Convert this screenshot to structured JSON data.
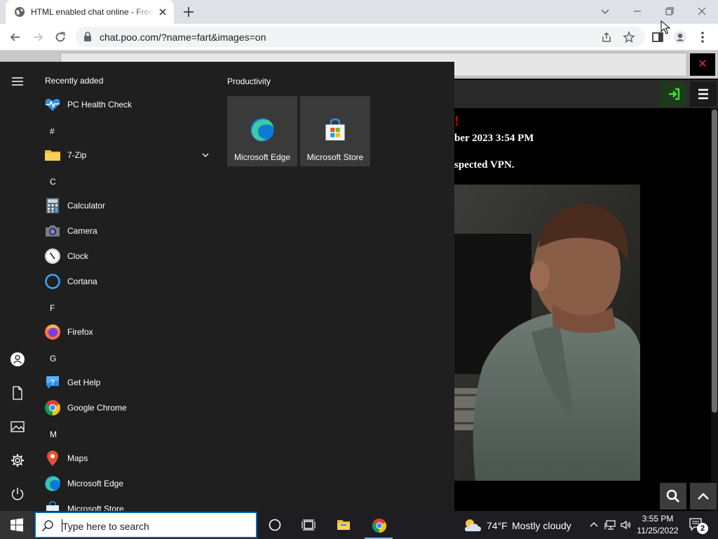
{
  "browser": {
    "tab_title": "HTML enabled chat online - Free",
    "url": "chat.poo.com/?name=fart&images=on"
  },
  "page": {
    "chat_lines": [
      "!",
      "ber 2023 3:54 PM",
      "spected VPN."
    ]
  },
  "start_menu": {
    "recent_header": "Recently added",
    "tiles_header": "Productivity",
    "tiles": [
      {
        "label": "Microsoft Edge",
        "icon": "edge-icon"
      },
      {
        "label": "Microsoft Store",
        "icon": "store-icon"
      }
    ],
    "apps": [
      {
        "label": "PC Health Check",
        "icon": "pc-health-check-icon"
      },
      {
        "letter": "#"
      },
      {
        "label": "7-Zip",
        "icon": "folder-icon"
      },
      {
        "letter": "C"
      },
      {
        "label": "Calculator",
        "icon": "calculator-icon"
      },
      {
        "label": "Camera",
        "icon": "camera-icon"
      },
      {
        "label": "Clock",
        "icon": "clock-icon"
      },
      {
        "label": "Cortana",
        "icon": "cortana-icon"
      },
      {
        "letter": "F"
      },
      {
        "label": "Firefox",
        "icon": "firefox-icon"
      },
      {
        "letter": "G"
      },
      {
        "label": "Get Help",
        "icon": "get-help-icon"
      },
      {
        "label": "Google Chrome",
        "icon": "chrome-icon"
      },
      {
        "letter": "M"
      },
      {
        "label": "Maps",
        "icon": "maps-icon"
      },
      {
        "label": "Microsoft Edge",
        "icon": "edge-icon"
      },
      {
        "label": "Microsoft Store",
        "icon": "store-icon"
      }
    ]
  },
  "taskbar": {
    "search_placeholder": "Type here to search",
    "weather_temp": "74°F",
    "weather_desc": "Mostly cloudy",
    "time": "3:55 PM",
    "date": "11/25/2022",
    "notification_count": "2"
  },
  "colors": {
    "accent": "#0063b1",
    "start_menu_bg": "#1f1f1f",
    "tile_bg": "#3a3a3a",
    "chat_alert": "#e00000"
  }
}
